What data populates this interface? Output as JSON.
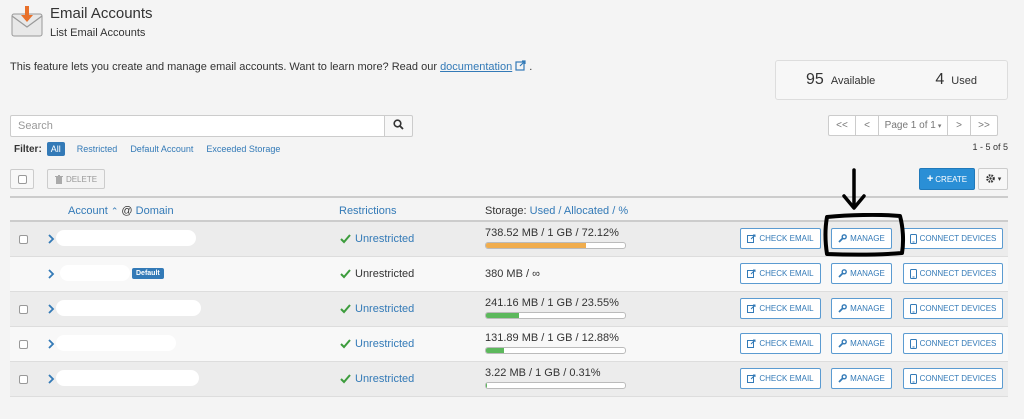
{
  "header": {
    "title": "Email Accounts",
    "subtitle": "List Email Accounts",
    "icon": "email-accounts-icon"
  },
  "description": {
    "text": "This feature lets you create and manage email accounts. Want to learn more? Read our",
    "link_text": "documentation",
    "suffix": "."
  },
  "stats": {
    "available_count": "95",
    "available_label": "Available",
    "used_count": "4",
    "used_label": "Used"
  },
  "search": {
    "placeholder": "Search"
  },
  "pagination": {
    "first": "<<",
    "prev": "<",
    "page_label": "Page 1 of 1",
    "next": ">",
    "last": ">>",
    "range": "1 - 5 of 5"
  },
  "filter": {
    "label": "Filter:",
    "options": [
      "All",
      "Restricted",
      "Default Account",
      "Exceeded Storage"
    ],
    "active": "All"
  },
  "toolbar": {
    "delete_label": "DELETE",
    "create_label": "CREATE"
  },
  "table": {
    "headers": {
      "account": "Account",
      "at": "@",
      "domain": "Domain",
      "restrictions": "Restrictions",
      "storage_prefix": "Storage:",
      "used": "Used",
      "slash1": "/",
      "allocated": "Allocated",
      "slash2": "/",
      "percent": "%"
    },
    "rows": [
      {
        "restriction": "Unrestricted",
        "storage": "738.52 MB / 1 GB / 72.12%",
        "percent": 72.12,
        "bar_color": "#f0ad4e",
        "default_badge": ""
      },
      {
        "restriction": "Unrestricted",
        "storage": "380 MB / ∞",
        "percent": null,
        "bar_color": "",
        "default_badge": "Default"
      },
      {
        "restriction": "Unrestricted",
        "storage": "241.16 MB / 1 GB / 23.55%",
        "percent": 23.55,
        "bar_color": "#5cb85c",
        "default_badge": ""
      },
      {
        "restriction": "Unrestricted",
        "storage": "131.89 MB / 1 GB / 12.88%",
        "percent": 12.88,
        "bar_color": "#5cb85c",
        "default_badge": ""
      },
      {
        "restriction": "Unrestricted",
        "storage": "3.22 MB / 1 GB / 0.31%",
        "percent": 0.31,
        "bar_color": "#5cb85c",
        "default_badge": ""
      }
    ],
    "actions": {
      "check_email": "CHECK EMAIL",
      "manage": "MANAGE",
      "connect_devices": "CONNECT DEVICES"
    }
  },
  "colors": {
    "accent": "#337ab7",
    "create_button": "#2a8fd6",
    "storage_warning": "#f0ad4e",
    "storage_ok": "#5cb85c",
    "check_green": "#3c9c3c"
  }
}
